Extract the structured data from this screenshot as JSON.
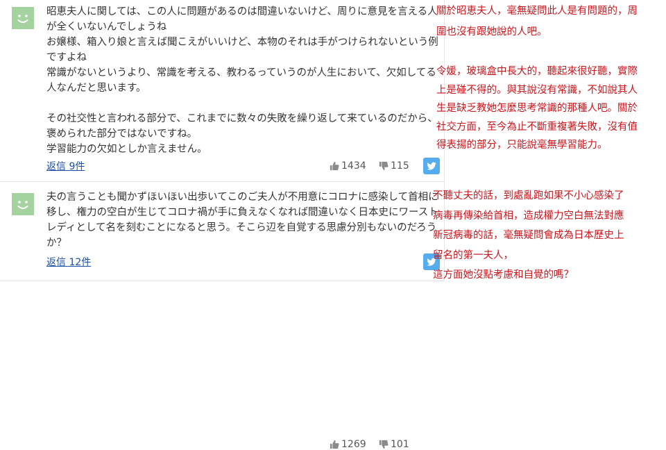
{
  "comments": [
    {
      "text": "昭恵夫人に関しては、この人に問題があるのは間違いないけど、周りに意見を言える人が全くいないんでしょうね\nお嬢様、箱入り娘と言えば聞こえがいいけど、本物のそれは手がつけられないという例ですよね\n常識がないというより、常識を考える、教わるっていうのが人生において、欠如してる人なんだと思います。\n\nその社交性と言われる部分で、これまでに数々の失敗を繰り返して来ているのだから、褒められた部分ではないですね。\n学習能力の欠如としか言えません。",
      "reply_label": "返信 9件",
      "likes": "1434",
      "dislikes": "115"
    },
    {
      "text": "夫の言うことも聞かずほいほい出歩いてこのご夫人が不用意にコロナに感染して首相に移し、権力の空白が生じてコロナ禍が手に負えなくなれば間違いなく日本史にワーストレディとして名を刻むことになると思う。そこら辺を自覚する思慮分別もないのだろうか？",
      "reply_label": "返信 12件",
      "likes": "1269",
      "dislikes": "101"
    }
  ],
  "annotations": {
    "a1": "關於昭恵夫人，毫無疑問此人是有問題的，周\n圍也沒有跟她說的人吧。",
    "a2": "令媛，玻璃盒中長大的，聽起來很好聽，實際\n上是碰不得的。與其說沒有常識，不如說其人\n生是缺乏教她怎麼思考常識的那種人吧。關於\n社交方面，至今為止不斷重複著失敗，沒有值\n得表揚的部分，只能說毫無學習能力。",
    "a3": "不聽丈夫的話，到處亂跑如果不小心感染了\n病毒再傳染給首相，造成權力空白無法對應\n新冠病毒的話，毫無疑問會成為日本歷史上\n留名的第一夫人，\n這方面她沒點考慮和自覺的嗎？"
  },
  "colors": {
    "avatar": "#a4d3a0",
    "link": "#1b4ea6",
    "annotation": "#c8161d",
    "twitter": "#55acee"
  },
  "icons": [
    "smiley-avatar",
    "thumbs-up-icon",
    "thumbs-down-icon",
    "twitter-icon"
  ]
}
